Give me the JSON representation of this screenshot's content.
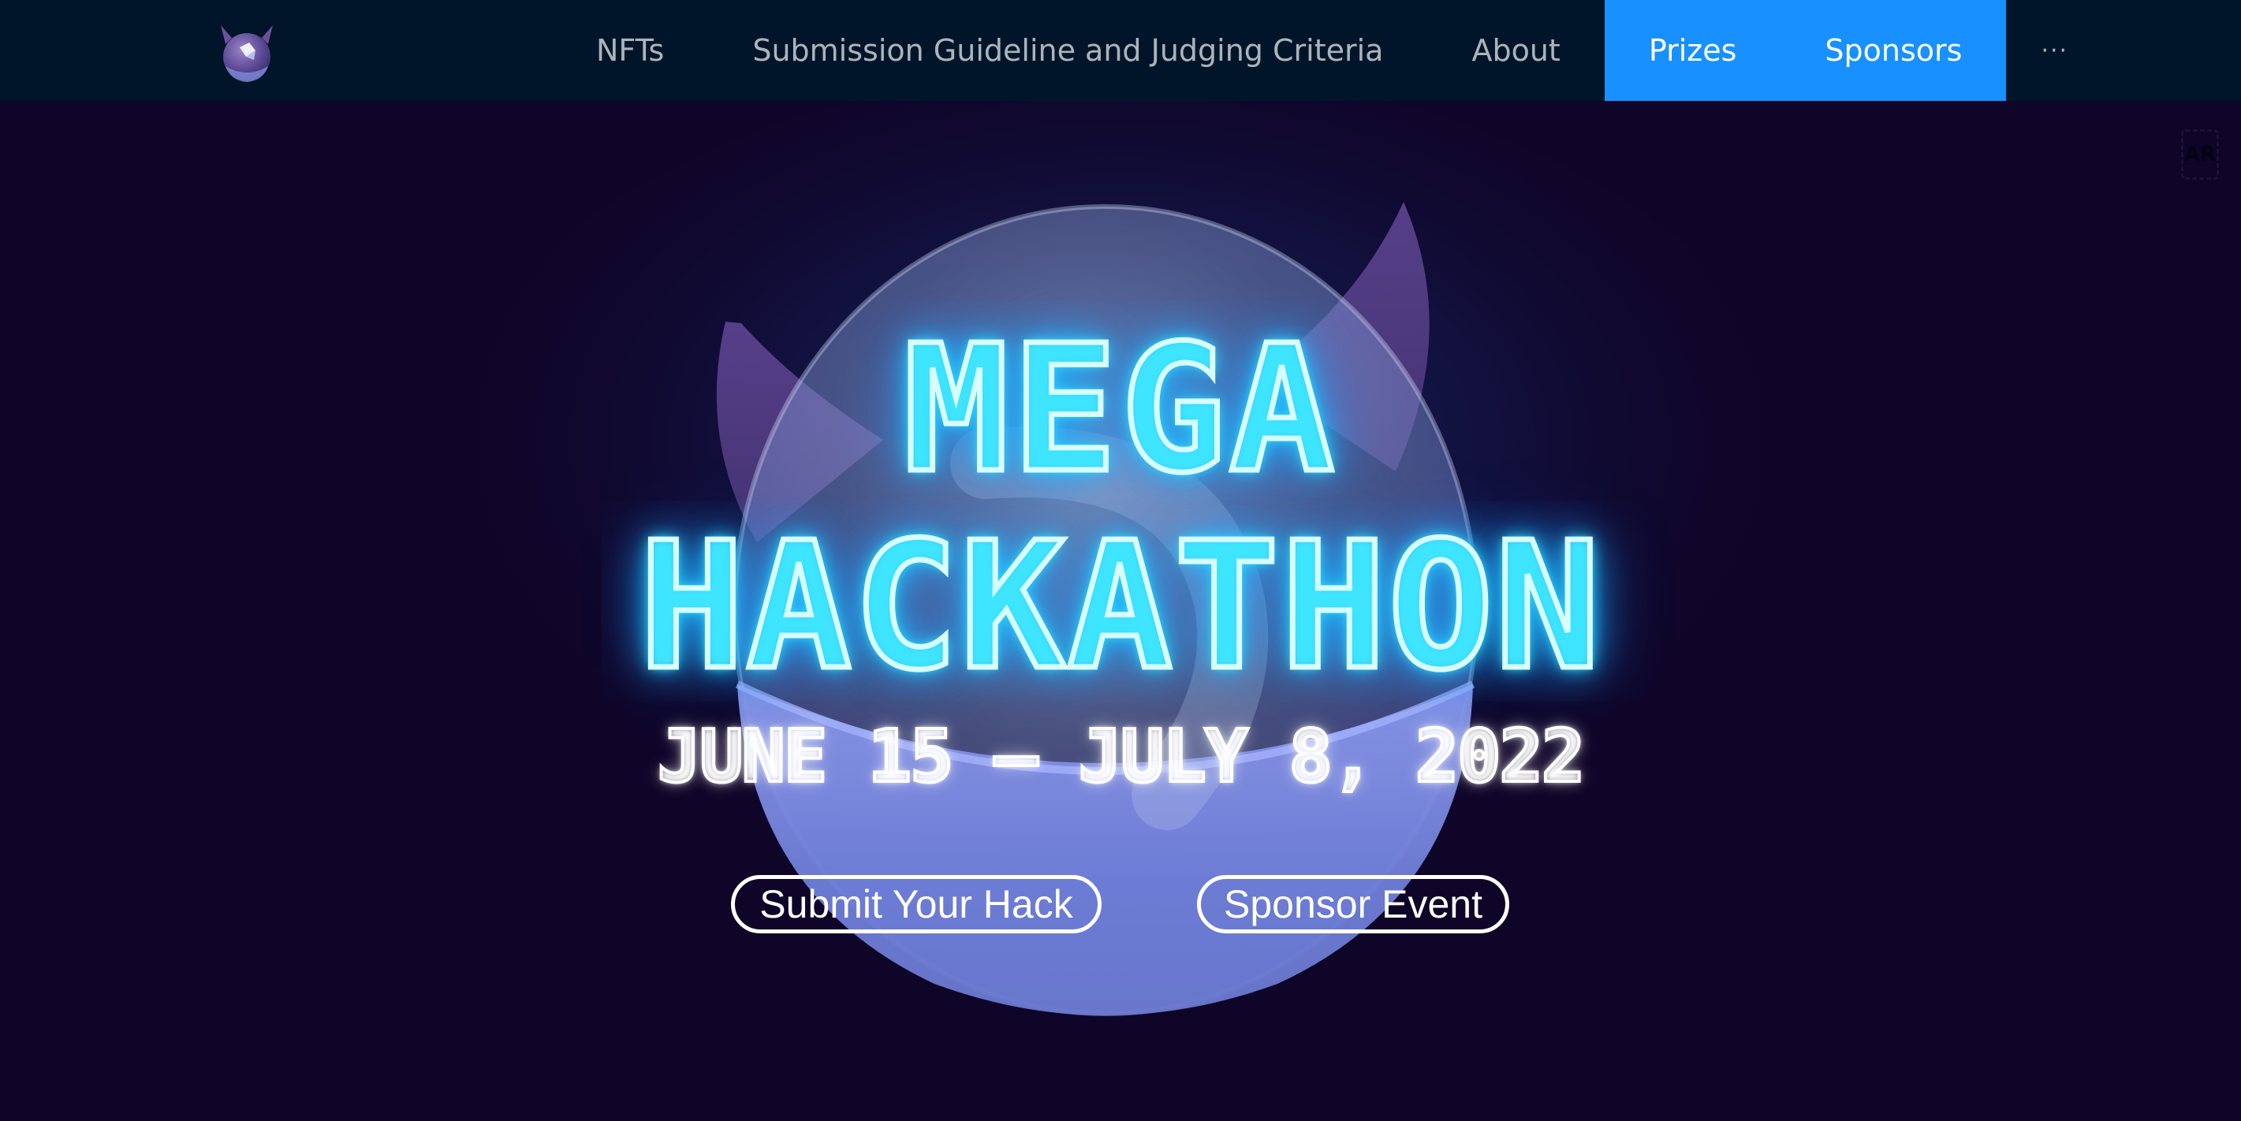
{
  "nav": {
    "logo_icon": "devil-helmet-logo-icon",
    "items": [
      {
        "label": "NFTs",
        "selected": false
      },
      {
        "label": "Submission Guideline and Judging Criteria",
        "selected": false
      },
      {
        "label": "About",
        "selected": false
      },
      {
        "label": "Prizes",
        "selected": true
      },
      {
        "label": "Sponsors",
        "selected": true
      }
    ],
    "more_label": "···",
    "colors": {
      "bar_background": "#001529",
      "selected_background": "#1890ff"
    }
  },
  "ar_badge": "AR",
  "hero": {
    "title_line1": "MEGA",
    "title_line2": "HACKATHON",
    "dates": "JUNE 15 – JULY 8, 2022",
    "mascot_icon": "glass-devil-mascot-icon",
    "buttons": {
      "submit": "Submit Your Hack",
      "sponsor": "Sponsor Event"
    },
    "colors": {
      "background": "#0f0528",
      "neon": "#35e4ff"
    }
  }
}
